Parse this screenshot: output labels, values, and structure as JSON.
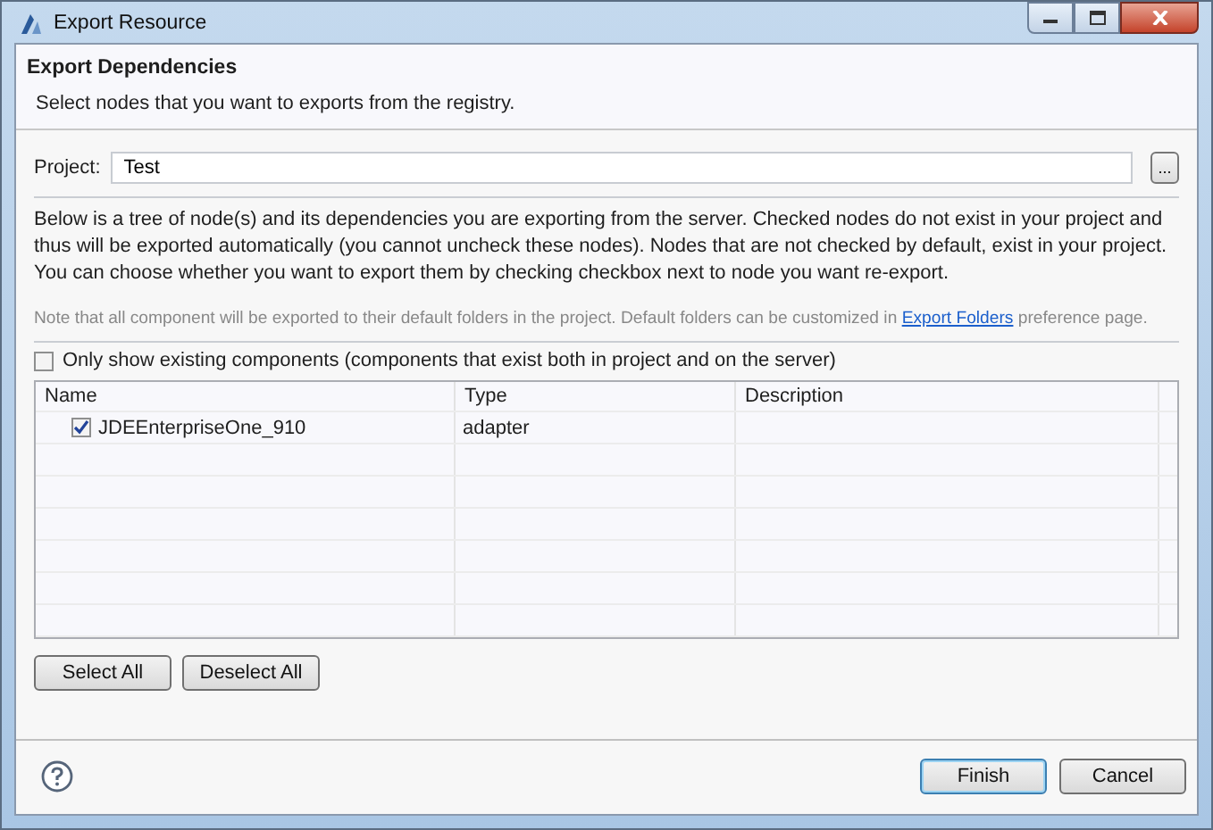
{
  "window": {
    "title": "Export Resource"
  },
  "header": {
    "title": "Export Dependencies",
    "subtitle": "Select nodes that you want to exports from the registry."
  },
  "project": {
    "label": "Project:",
    "value": "Test",
    "browse": "..."
  },
  "description": "Below is a tree of node(s) and its dependencies you are exporting from the server. Checked nodes do not exist in your project and thus will be exported automatically (you cannot uncheck these nodes). Nodes that are not checked by default, exist in your project. You can choose whether you want to export them by checking checkbox next to node you want re-export.",
  "note": {
    "before": "Note that all component will be exported to their default folders in the project. Default folders can be customized in ",
    "link": "Export Folders",
    "after": " preference page."
  },
  "filter": {
    "label": "Only show existing components (components that exist both in project and on the server)",
    "checked": false
  },
  "table": {
    "columns": [
      "Name",
      "Type",
      "Description"
    ],
    "rows": [
      {
        "name": "JDEEnterpriseOne_910",
        "type": "adapter",
        "checked": true
      }
    ]
  },
  "selection_buttons": [
    "Select All",
    "Deselect All"
  ],
  "buttons": [
    {
      "label": "Finish",
      "selected": true
    },
    {
      "label": "Cancel",
      "selected": false
    }
  ]
}
